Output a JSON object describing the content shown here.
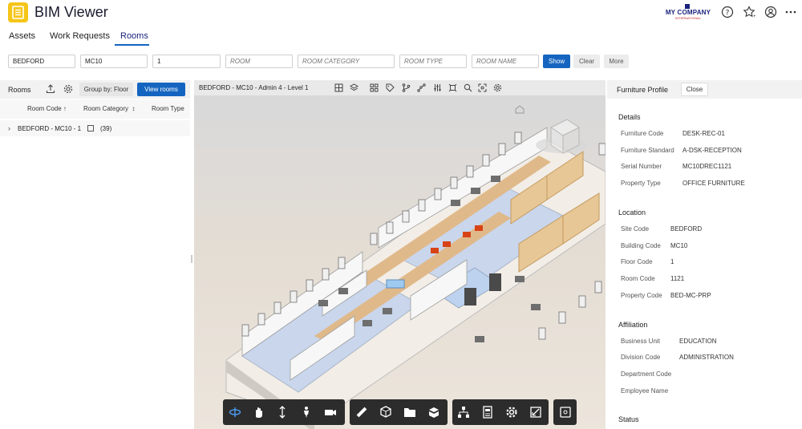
{
  "app": {
    "title": "BIM Viewer",
    "company_name": "MY COMPANY",
    "company_sub": "INTERNATIONAL"
  },
  "tabs": [
    {
      "label": "Assets"
    },
    {
      "label": "Work Requests"
    },
    {
      "label": "Rooms",
      "active": true
    }
  ],
  "filters": {
    "site": "BEDFORD",
    "building": "MC10",
    "floor": "1",
    "room_placeholder": "ROOM",
    "room_category_placeholder": "ROOM CATEGORY",
    "room_type_placeholder": "ROOM TYPE",
    "room_name_placeholder": "ROOM NAME",
    "show_label": "Show",
    "clear_label": "Clear",
    "more_label": "More"
  },
  "rooms_panel": {
    "title": "Rooms",
    "group_by_label": "Group by: Floor",
    "view_rooms_label": "View rooms",
    "columns": [
      "Room Code",
      "Room Category",
      "Room Type"
    ],
    "sort_up": "↑",
    "sort_both": "↕",
    "rows": [
      {
        "label": "BEDFORD - MC10 - 1",
        "count": "(39)"
      }
    ]
  },
  "viewer": {
    "title": "BEDFORD - MC10 - Admin 4 - Level 1"
  },
  "profile": {
    "title": "Furniture Profile",
    "close_label": "Close",
    "sections": {
      "details": "Details",
      "location": "Location",
      "affiliation": "Affiliation",
      "status": "Status"
    },
    "details": [
      {
        "label": "Furniture Code",
        "value": "DESK-REC-01"
      },
      {
        "label": "Furniture Standard",
        "value": "A-DSK-RECEPTION"
      },
      {
        "label": "Serial Number",
        "value": "MC10DREC1121"
      },
      {
        "label": "Property Type",
        "value": "OFFICE FURNITURE"
      }
    ],
    "location": [
      {
        "label": "Site Code",
        "value": "BEDFORD"
      },
      {
        "label": "Building Code",
        "value": "MC10"
      },
      {
        "label": "Floor Code",
        "value": "1"
      },
      {
        "label": "Room Code",
        "value": "1121"
      },
      {
        "label": "Property Code",
        "value": "BED-MC-PRP"
      }
    ],
    "affiliation": [
      {
        "label": "Business Unit",
        "value": "EDUCATION"
      },
      {
        "label": "Division Code",
        "value": "ADMINISTRATION"
      },
      {
        "label": "Department Code",
        "value": ""
      },
      {
        "label": "Employee Name",
        "value": ""
      }
    ]
  },
  "colors": {
    "accent": "#1565c0",
    "logo": "#f5c518",
    "company": "#1a237e"
  }
}
